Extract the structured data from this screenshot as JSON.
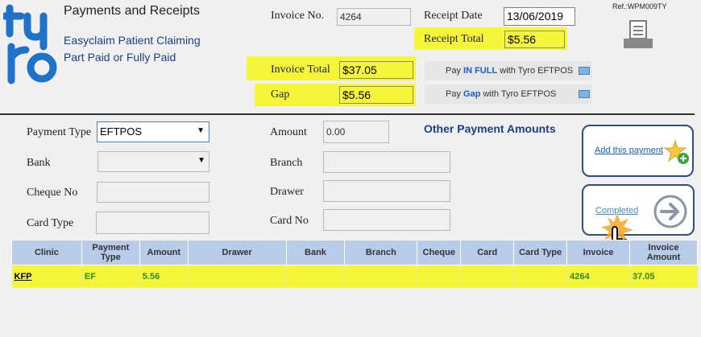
{
  "header": {
    "title": "Payments and Receipts",
    "subtitle1": "Easyclaim Patient Claiming",
    "subtitle2": "Part Paid or Fully Paid",
    "ref": "Ref.:WPM009TY"
  },
  "invoice": {
    "invoice_no_label": "Invoice No.",
    "invoice_no": "4264",
    "receipt_date_label": "Receipt Date",
    "receipt_date": "13/06/2019",
    "receipt_total_label": "Receipt Total",
    "receipt_total": "$5.56",
    "invoice_total_label": "Invoice Total",
    "invoice_total": "$37.05",
    "gap_label": "Gap",
    "gap": "$5.56"
  },
  "tyro": {
    "full_prefix": "Pay ",
    "full_emph": "IN FULL",
    "full_suffix": " with Tyro EFTPOS",
    "gap_prefix": "Pay ",
    "gap_emph": "Gap",
    "gap_suffix": " with Tyro EFTPOS"
  },
  "form": {
    "payment_type_label": "Payment Type",
    "payment_type": "EFTPOS",
    "bank_label": "Bank",
    "bank": "",
    "cheque_no_label": "Cheque No",
    "card_type_label": "Card Type",
    "amount_label": "Amount",
    "amount": "0.00",
    "branch_label": "Branch",
    "drawer_label": "Drawer",
    "card_no_label": "Card No",
    "other_payments_title": "Other Payment Amounts"
  },
  "actions": {
    "add_payment": "Add this payment",
    "completed": "Completed"
  },
  "table": {
    "headers": [
      "Clinic",
      "Payment Type",
      "Amount",
      "Drawer",
      "Bank",
      "Branch",
      "Cheque",
      "Card",
      "Card Type",
      "Invoice",
      "Invoice Amount"
    ],
    "rows": [
      [
        "KFP",
        "EF",
        "5.56",
        "",
        "",
        "",
        "",
        "",
        "",
        "4264",
        "37.05"
      ]
    ]
  }
}
